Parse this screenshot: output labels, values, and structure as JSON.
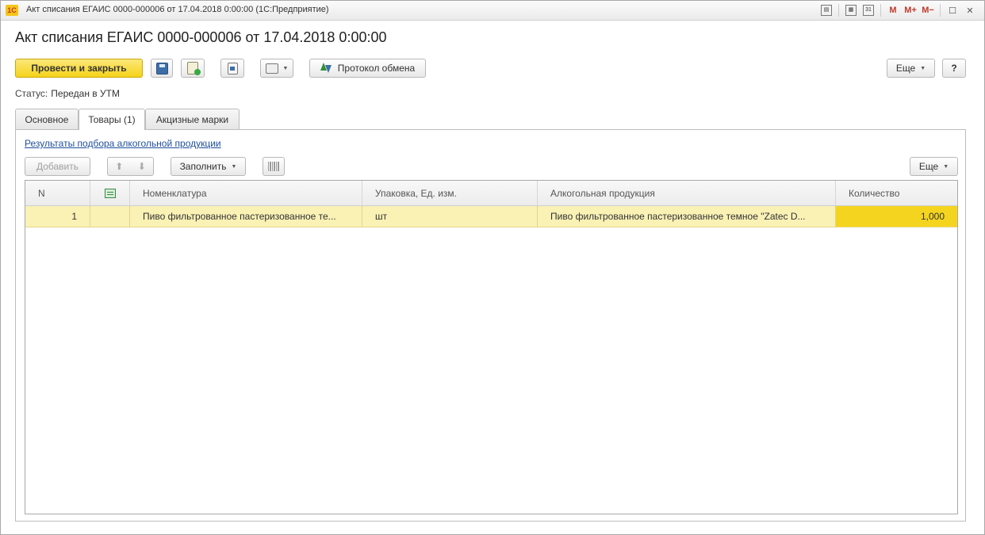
{
  "window": {
    "title": "Акт списания ЕГАИС 0000-000006 от 17.04.2018 0:00:00  (1С:Предприятие)",
    "logo": "1С",
    "controls": {
      "m": "M",
      "m_plus": "M+",
      "m_minus": "M−",
      "calendar_day": "31"
    }
  },
  "form": {
    "title": "Акт списания ЕГАИС 0000-000006 от 17.04.2018 0:00:00",
    "status_label": "Статус:",
    "status_value": "Передан в УТМ"
  },
  "toolbar": {
    "post_close": "Провести и закрыть",
    "exchange_log": "Протокол обмена",
    "more": "Еще",
    "help": "?"
  },
  "tabs": [
    {
      "label": "Основное",
      "active": false
    },
    {
      "label": "Товары (1)",
      "active": true
    },
    {
      "label": "Акцизные марки",
      "active": false
    }
  ],
  "goods": {
    "selection_link": "Результаты подбора алкогольной продукции",
    "add": "Добавить",
    "fill": "Заполнить",
    "more": "Еще",
    "columns": [
      "N",
      "",
      "Номенклатура",
      "Упаковка, Ед. изм.",
      "Алкогольная продукция",
      "Количество"
    ],
    "rows": [
      {
        "n": "1",
        "mark": "",
        "nomenclature": "Пиво фильтрованное пастеризованное те...",
        "unit": "шт",
        "alcohol": "Пиво фильтрованное пастеризованное темное \"Zatec D...",
        "qty": "1,000"
      }
    ]
  },
  "icons": {
    "app": "1c-logo-icon",
    "save": "save-icon",
    "post": "post-document-icon",
    "related": "related-documents-icon",
    "print": "print-icon",
    "exchange": "exchange-arrows-icon",
    "up": "arrow-up-icon",
    "down": "arrow-down-icon",
    "barcode": "barcode-icon",
    "table": "table-icon"
  },
  "colors": {
    "accent": "#f5d31a",
    "row_highlight": "#faf1b5",
    "qty_cell": "#f5d41f",
    "link": "#1f4f9c"
  }
}
